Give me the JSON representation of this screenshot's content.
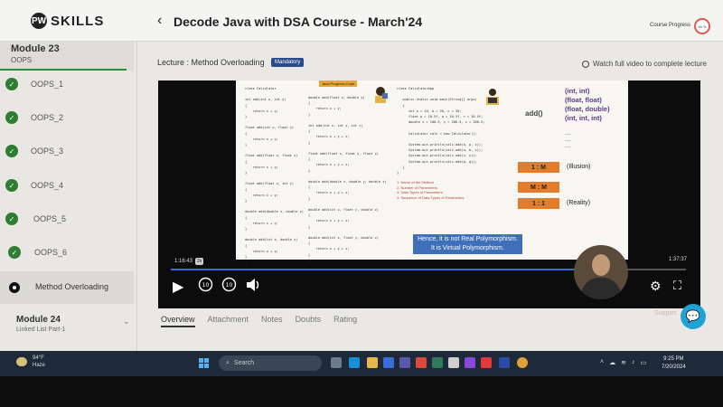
{
  "header": {
    "logo_mark": "PW",
    "logo_text": "SKILLS",
    "back_icon": "chevron-left-icon",
    "course_title": "Decode Java with DSA Course - March'24",
    "progress_label": "Course Progress",
    "progress_value": "40 %"
  },
  "sidebar": {
    "module": {
      "title": "Module 23",
      "subtitle": "OOPS"
    },
    "items": [
      {
        "label": "OOPS_1",
        "status": "done"
      },
      {
        "label": "OOPS_2",
        "status": "done"
      },
      {
        "label": "OOPS_3",
        "status": "done"
      },
      {
        "label": "OOPS_4",
        "status": "done"
      },
      {
        "label": "OOPS_5",
        "status": "done"
      },
      {
        "label": "OOPS_6",
        "status": "done"
      },
      {
        "label": "Method Overloading",
        "status": "current"
      }
    ],
    "next_module": {
      "title": "Module 24",
      "subtitle": "Linked List Part-1"
    }
  },
  "lecture": {
    "title": "Lecture : Method Overloading",
    "badge": "Mandatory",
    "watch_note": "Watch full video to complete lecture"
  },
  "slide": {
    "banner": "Java Progress Code",
    "code_left": "class Calculator\n\nint add(int x, int y)\n{\n    return x + y;\n}\n\nfloat add(int x, float y)\n{\n    return x + y;\n}\n\nfloat add(float x, float y)\n{\n    return x + y;\n}\n\nfloat add(float x, int y)\n{\n    return x + y;\n}\n\ndouble add(double x, double y)\n{\n    return x + y;\n}\n\ndouble add(int x, double y)\n{\n    return x + y;\n}\n}",
    "code_mid": "double add(float x, double y)\n{\n    return x + y;\n}\n\nint add(int x, int y, int z)\n{\n    return x + y + z;\n}\n\nfloat add(float x, float y, float z)\n{\n    return x + y + z;\n}\n\ndouble add(double x, double y, double z)\n{\n    return x + y + z;\n}\n\ndouble add(int x, float y, double z)\n{\n    return x + y + z;\n}\n\ndouble add(int x, float y, double z)\n{\n    return x + y + z;\n}\n}",
    "code_right": "class CalculatorApp\n\n   public static void main(String[] args)\n   {\n      int a = 10, b = 20, c = 30;\n      float p = 10.5f, q = 20.5f, r = 30.5f;\n      double x = 100.5, y = 200.5, z = 300.5;\n\n      Calculator calc = new Calculator();\n\n      System.out.println(calc.add(a, p, x));\n      System.out.println(calc.add(a, b, c));\n      System.out.println(calc.add(x, y));\n      System.out.println(calc.add(p, q));\n   }\n}",
    "list": [
      "1. Name of the Method",
      "2. Number of Parameters",
      "3. Data Types of Parameters",
      "4. Sequence of Data Types of Parameters"
    ],
    "add_label": "add()",
    "rhs_types": [
      "(int, int)",
      "(float, float)",
      "(float, double)",
      "(int, int, int)"
    ],
    "dots": [
      "....",
      "....",
      "...."
    ],
    "ratio_1": "1 : M",
    "ratio_1_note": "(Illusion)",
    "ratio_2": "M : M",
    "ratio_3": "1 : 1",
    "ratio_3_note": "(Reality)",
    "subtitle_line1": "Hence, it is not Real Polymorphism.",
    "subtitle_line2": "It is Virtual Polymorphism."
  },
  "player": {
    "current_time": "1:16:43",
    "speed": "2x",
    "duration": "1:37:37",
    "progress": 0.786
  },
  "tabs": [
    "Overview",
    "Attachment",
    "Notes",
    "Doubts",
    "Rating"
  ],
  "support_label": "Support",
  "taskbar": {
    "temp": "94°F",
    "weather": "Haze",
    "search_placeholder": "Search",
    "time": "9:25 PM",
    "date": "7/20/2024"
  }
}
